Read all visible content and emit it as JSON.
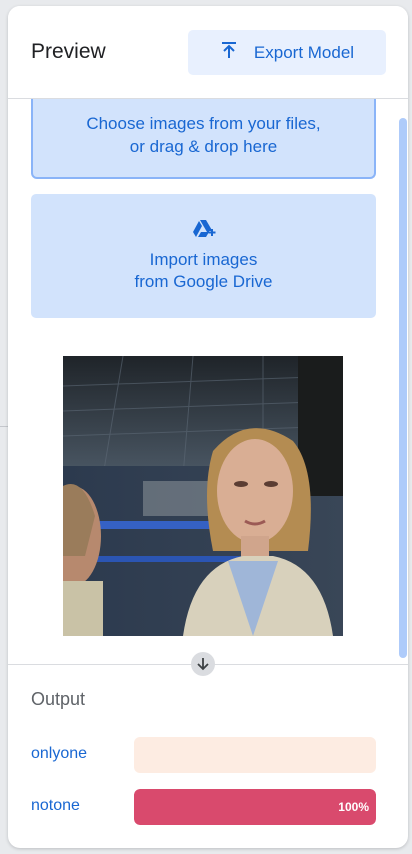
{
  "header": {
    "title": "Preview",
    "export_label": "Export Model"
  },
  "upload": {
    "drop_line1": "Choose images from your files,",
    "drop_line2": "or drag & drop here",
    "drive_line1": "Import images",
    "drive_line2": "from Google Drive"
  },
  "output": {
    "title": "Output",
    "classes": [
      {
        "label": "onlyone",
        "percent": 0,
        "percent_text": "",
        "track_color": "#fdece2",
        "fill_color": "#f9a07a"
      },
      {
        "label": "notone",
        "percent": 100,
        "percent_text": "100%",
        "track_color": "#fce4ec",
        "fill_color": "#d94a6d"
      }
    ]
  },
  "icons": {
    "export": "upload-arrow-icon",
    "drive": "google-drive-icon",
    "divider": "arrow-down-icon"
  },
  "colors": {
    "accent": "#1967d2",
    "button_bg": "#e8f0fe",
    "upload_bg": "#d2e3fc"
  }
}
